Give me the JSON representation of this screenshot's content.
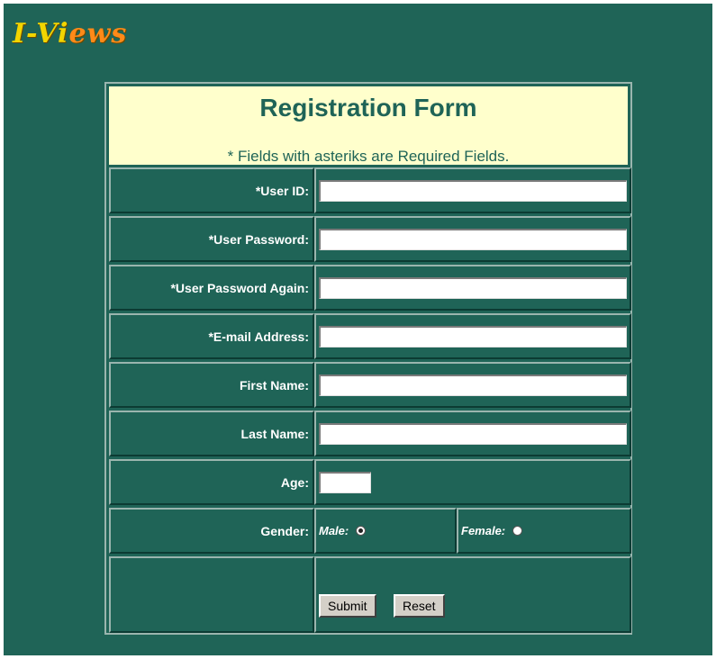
{
  "logo": {
    "part1": "I-Vi",
    "part2": "ews"
  },
  "form": {
    "title": "Registration Form",
    "note": "* Fields with asteriks are Required Fields.",
    "fields": {
      "user_id": {
        "label": "*User ID:",
        "value": ""
      },
      "user_password": {
        "label": "*User Password:",
        "value": ""
      },
      "user_password_again": {
        "label": "*User Password Again:",
        "value": ""
      },
      "email": {
        "label": "*E-mail Address:",
        "value": ""
      },
      "first_name": {
        "label": "First Name:",
        "value": ""
      },
      "last_name": {
        "label": "Last Name:",
        "value": ""
      },
      "age": {
        "label": "Age:",
        "value": ""
      }
    },
    "gender": {
      "label": "Gender:",
      "male_label": "Male:",
      "female_label": "Female:"
    },
    "buttons": {
      "submit": "Submit",
      "reset": "Reset"
    }
  },
  "colors": {
    "background": "#1f6457",
    "header_bg": "#ffffcc",
    "logo_yellow": "#f2d500",
    "logo_orange": "#ff8a18"
  }
}
